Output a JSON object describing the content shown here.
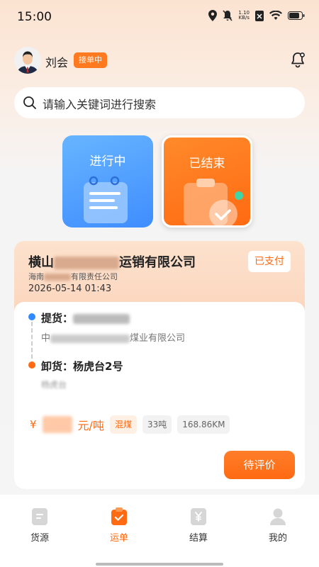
{
  "status": {
    "time": "15:00",
    "net_speed_value": "1.10",
    "net_speed_unit": "KB/s"
  },
  "user": {
    "name": "刘会",
    "status_badge": "接单中"
  },
  "search": {
    "placeholder": "请输入关键词进行搜索"
  },
  "filters": [
    {
      "label": "进行中",
      "active": false
    },
    {
      "label": "已结束",
      "active": true
    }
  ],
  "order": {
    "company_prefix": "横山",
    "company_suffix": "运销有限公司",
    "sub_prefix": "海南",
    "sub_suffix": "有限责任公司",
    "time": "2026-05-14 01:43",
    "pay_status": "已支付",
    "pickup_label": "提货：",
    "pickup_addr_prefix": "中",
    "pickup_addr_suffix": "煤业有限公司",
    "drop_label": "卸货：杨虎台2号",
    "drop_addr": "杨虎台",
    "price_currency": "¥",
    "price_unit": "元/吨",
    "tags": [
      "混煤",
      "33吨",
      "168.86KM"
    ],
    "action": "待评价"
  },
  "tabs": [
    {
      "label": "货源",
      "active": false
    },
    {
      "label": "运单",
      "active": true
    },
    {
      "label": "结算",
      "active": false
    },
    {
      "label": "我的",
      "active": false
    }
  ],
  "colors": {
    "accent": "#ff6a12",
    "blue": "#3f8dff"
  }
}
